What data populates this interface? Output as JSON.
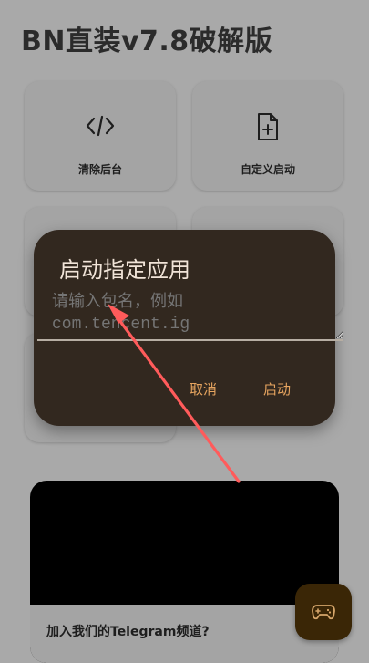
{
  "app": {
    "title": "BN直装v7.8破解版"
  },
  "cards": [
    {
      "label": "清除后台",
      "icon": "code-icon"
    },
    {
      "label": "自定义启动",
      "icon": "file-add-icon"
    },
    {
      "label": "",
      "icon": ""
    },
    {
      "label": "",
      "icon": ""
    },
    {
      "label": "",
      "icon": ""
    }
  ],
  "banner": {
    "text": "加入我们的Telegram频道?"
  },
  "fab": {
    "icon": "gamepad-icon"
  },
  "dialog": {
    "title": "启动指定应用",
    "input_placeholder": "请输入包名，例如\ncom.tencent.ig",
    "cancel_label": "取消",
    "confirm_label": "启动",
    "accent_color": "#e6a45f"
  },
  "annotation": {
    "arrow_color": "#ff5b5b"
  }
}
